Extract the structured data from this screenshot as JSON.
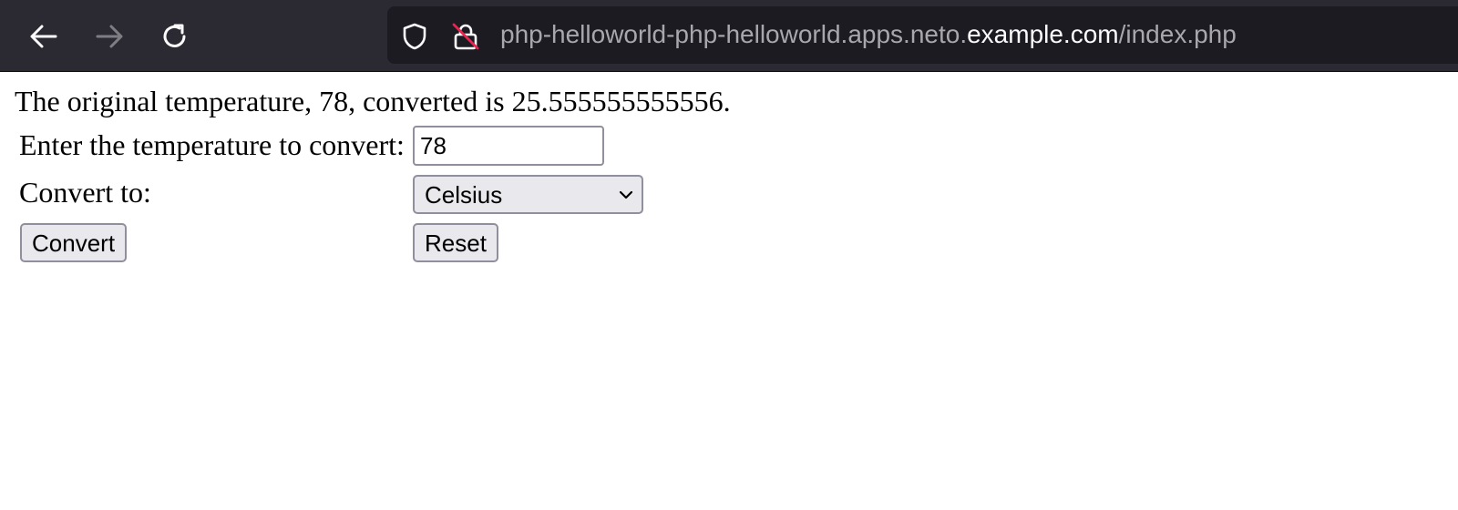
{
  "browser": {
    "url_prefix": "php-helloworld-php-helloworld.apps.neto.",
    "url_host": "example.com",
    "url_path": "/index.php",
    "icons": {
      "back": "back-arrow-icon",
      "forward": "forward-arrow-icon",
      "reload": "reload-icon",
      "tracking": "shield-icon",
      "security": "insecure-lock-icon"
    },
    "colors": {
      "toolbar": "#2b2a33",
      "urlbar": "#1c1b22",
      "insecure_strike": "#e22850"
    }
  },
  "page": {
    "result_text": "The original temperature, 78, converted is 25.555555555556.",
    "temp_label": "Enter the temperature to convert:",
    "temp_value": "78",
    "convert_to_label": "Convert to:",
    "convert_to_selected": "Celsius",
    "convert_button": "Convert",
    "reset_button": "Reset"
  }
}
